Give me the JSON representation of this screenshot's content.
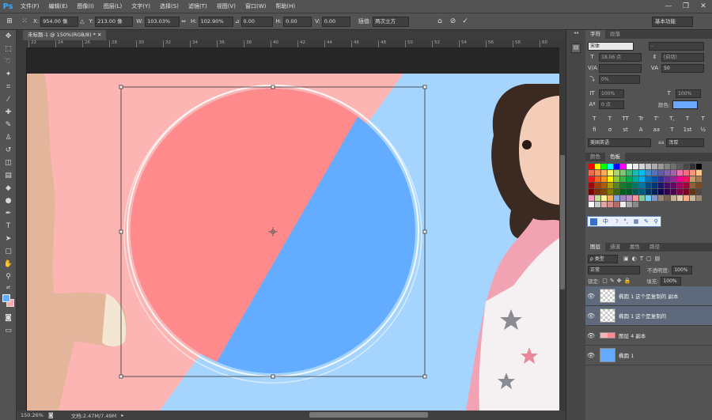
{
  "app": {
    "logo": "Ps"
  },
  "menu": [
    "文件(F)",
    "编辑(E)",
    "图像(I)",
    "图层(L)",
    "文字(Y)",
    "选择(S)",
    "滤镜(T)",
    "视图(V)",
    "窗口(W)",
    "帮助(H)"
  ],
  "options": {
    "x_label": "X:",
    "x_value": "954.00 像",
    "y_label": "Y:",
    "y_value": "213.00 像",
    "w_label": "W:",
    "w_value": "103.03%",
    "h_label": "H:",
    "h_value": "102.90%",
    "angle_value": "0.00",
    "hskew_label": "H:",
    "hskew_value": "0.00",
    "vskew_label": "V:",
    "vskew_value": "0.00",
    "interp_label": "插值:",
    "interp_value": "两次立方",
    "workspace": "基本功能"
  },
  "document": {
    "tab_title": "未标题-1 @ 150%(RGB/8) *",
    "zoom": "150.26%",
    "doc_info": "文档:2.47M/7.49M"
  },
  "ruler_ticks": [
    "22",
    "24",
    "26",
    "28",
    "30",
    "32",
    "34",
    "36",
    "38",
    "40",
    "42",
    "44",
    "46",
    "48",
    "50",
    "52",
    "54",
    "56",
    "58",
    "60"
  ],
  "char_panel": {
    "tabs": [
      "字符",
      "段落"
    ],
    "font_family": "宋体",
    "font_style": "-",
    "font_size": "18.06 点",
    "leading": "(自动)",
    "kerning": "",
    "tracking": "50",
    "vscale": "0%",
    "hscale_v": "100%",
    "hscale_h": "100%",
    "baseline": "0 点",
    "color_label": "颜色:",
    "styles": [
      "T",
      "T",
      "TT",
      "Tr",
      "T'",
      "T,",
      "T",
      "T"
    ],
    "styles2": [
      "fi",
      "σ",
      "st",
      "A",
      "aa",
      "T",
      "1st",
      "½"
    ],
    "language": "美国英语",
    "antialias": "浑厚"
  },
  "swatch_panel": {
    "tabs": [
      "颜色",
      "色板"
    ]
  },
  "ime_bar": [
    "中",
    "☽",
    "°,",
    "▦",
    "✎",
    "⚲"
  ],
  "layers_panel": {
    "tabs": [
      "图层",
      "通道",
      "属性",
      "路径"
    ],
    "filter": "ρ 类型",
    "blend_mode": "正常",
    "opacity_label": "不透明度:",
    "opacity_value": "100%",
    "lock_label": "锁定:",
    "fill_label": "填充:",
    "fill_value": "100%",
    "layers": [
      {
        "name": "椭圆 1 这个是复制的 副本",
        "selected": true
      },
      {
        "name": "椭圆 1 这个是复制的",
        "selected": true
      },
      {
        "name": "图层 4 副本",
        "selected": false
      },
      {
        "name": "椭圆 1",
        "selected": false
      }
    ]
  },
  "colors": {
    "canvas_pink": "#fdb5b3",
    "canvas_blue": "#a5d4ff",
    "circle_red": "#ff8a8c",
    "circle_blue": "#63acff",
    "ps_blue": "#31a8ff",
    "font_color": "#6aa8ff"
  }
}
